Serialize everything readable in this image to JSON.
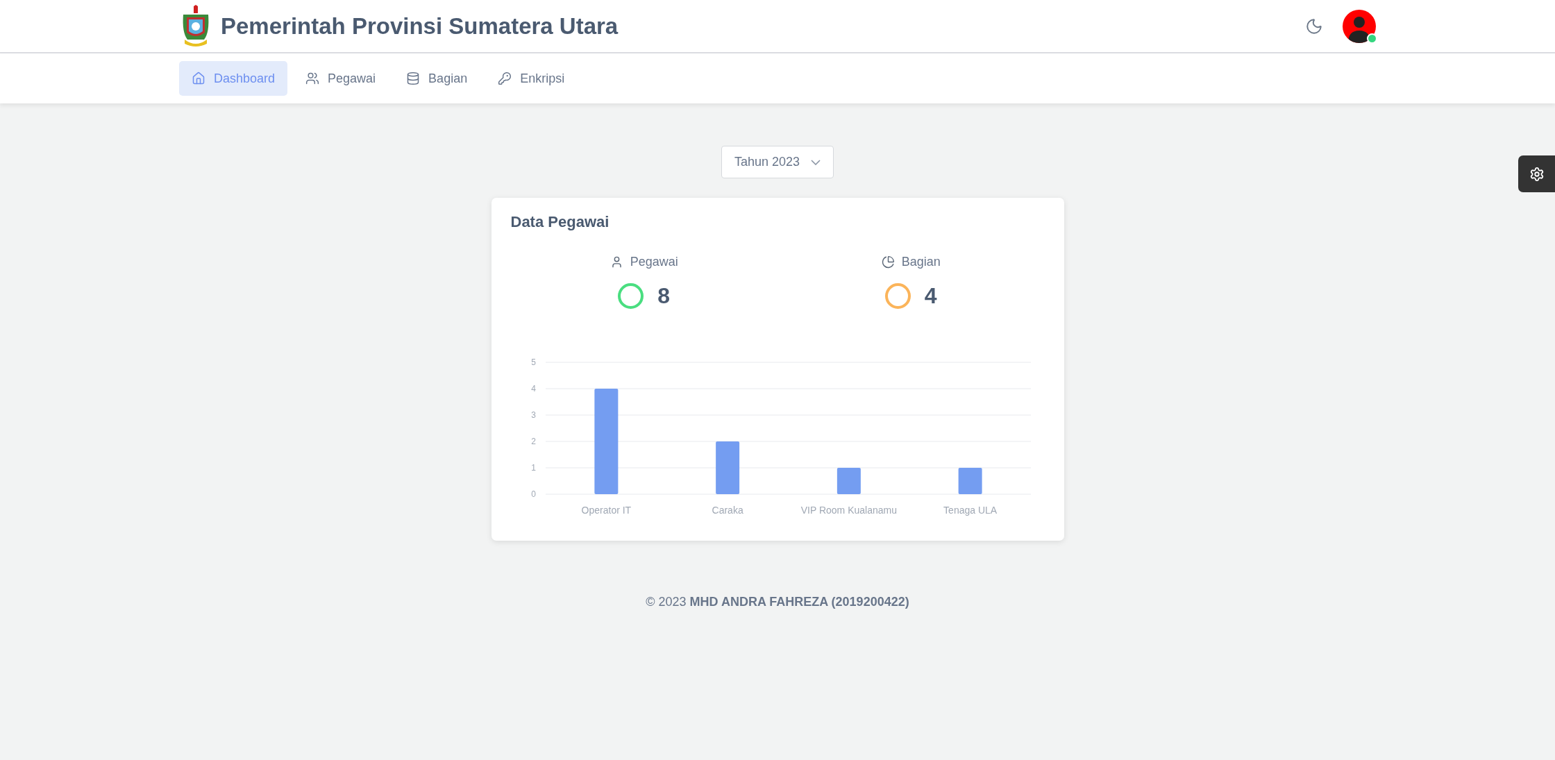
{
  "header": {
    "title": "Pemerintah Provinsi Sumatera Utara"
  },
  "nav": [
    {
      "label": "Dashboard",
      "selected": true
    },
    {
      "label": "Pegawai",
      "selected": false
    },
    {
      "label": "Bagian",
      "selected": false
    },
    {
      "label": "Enkripsi",
      "selected": false
    }
  ],
  "year_select": {
    "value": "Tahun 2023"
  },
  "card": {
    "title": "Data Pegawai",
    "stats": [
      {
        "label": "Pegawai",
        "value": "8",
        "color": "#4ade80"
      },
      {
        "label": "Bagian",
        "value": "4",
        "color": "#fbb45a"
      }
    ],
    "chart_data": {
      "type": "bar",
      "grid": true,
      "categories": [
        "Operator IT",
        "Caraka",
        "VIP Room Kualanamu",
        "Tenaga ULA"
      ],
      "values": [
        4,
        2,
        1,
        1
      ],
      "ylim": [
        0,
        5
      ],
      "yticks": [
        0,
        1,
        2,
        3,
        4,
        5
      ]
    }
  },
  "footer": {
    "text": "© 2023 **MHD ANDRA FAHREZA (2019200422)**"
  }
}
